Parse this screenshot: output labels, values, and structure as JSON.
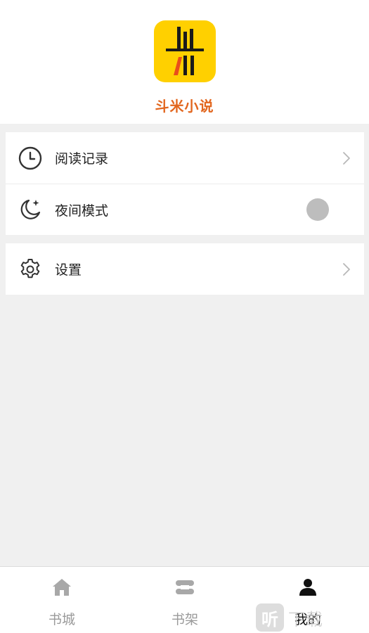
{
  "header": {
    "app_name": "斗米小说",
    "logo_icon": "bookshelf-logo-icon",
    "logo_color": "#ffd000",
    "name_color": "#e2661e"
  },
  "menu": {
    "group1": [
      {
        "label": "阅读记录",
        "icon": "clock-icon",
        "trailing": "chevron-right-icon"
      },
      {
        "label": "夜间模式",
        "icon": "moon-icon",
        "trailing": "toggle"
      }
    ],
    "group2": [
      {
        "label": "设置",
        "icon": "gear-icon",
        "trailing": "chevron-right-icon"
      }
    ]
  },
  "night_mode": {
    "enabled": false,
    "knob_color": "#bdbdbd"
  },
  "tabbar": {
    "tabs": [
      {
        "label": "书城",
        "icon": "home-icon",
        "active": false
      },
      {
        "label": "书架",
        "icon": "bookshelf-icon",
        "active": false
      },
      {
        "label": "我的",
        "icon": "user-icon",
        "active": true
      }
    ],
    "inactive_color": "#9a9a9a",
    "active_color": "#111111"
  },
  "watermark": {
    "char": "听",
    "text": "下载"
  }
}
